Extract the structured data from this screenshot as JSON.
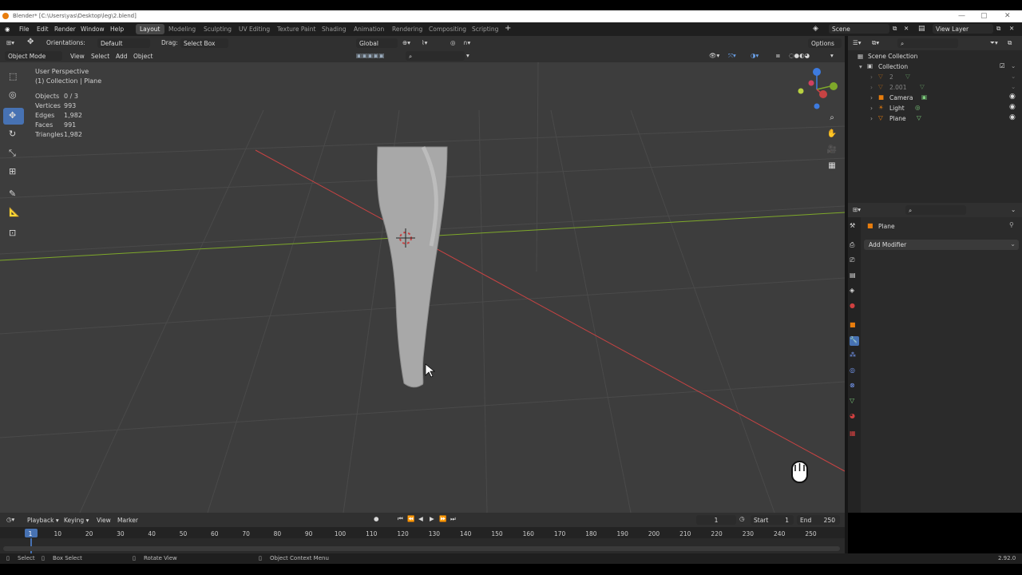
{
  "window_title": "Blender* [C:\\Users\\yas\\Desktop\\leg\\2.blend]",
  "menu": [
    "File",
    "Edit",
    "Render",
    "Window",
    "Help"
  ],
  "workspaces": [
    "Layout",
    "Modeling",
    "Sculpting",
    "UV Editing",
    "Texture Paint",
    "Shading",
    "Animation",
    "Rendering",
    "Compositing",
    "Scripting"
  ],
  "active_workspace": "Layout",
  "scene_field": "Scene",
  "view_layer_field": "View Layer",
  "header": {
    "orientation_label": "Orientations:",
    "orientation_value": "Default",
    "drag_label": "Drag:",
    "drag_value": "Select Box",
    "transform_orientation": "Global",
    "options_label": "Options"
  },
  "header2": {
    "mode": "Object Mode",
    "menus": [
      "View",
      "Select",
      "Add",
      "Object"
    ]
  },
  "viewport": {
    "perspective": "User Perspective",
    "collection": "(1) Collection | Plane",
    "stats": [
      {
        "label": "Objects",
        "value": "0 / 3"
      },
      {
        "label": "Vertices",
        "value": "993"
      },
      {
        "label": "Edges",
        "value": "1,982"
      },
      {
        "label": "Faces",
        "value": "991"
      },
      {
        "label": "Triangles",
        "value": "1,982"
      }
    ]
  },
  "outliner": {
    "rows": [
      {
        "label": "Scene Collection",
        "depth": 0
      },
      {
        "label": "Collection",
        "depth": 1
      },
      {
        "label": "2",
        "depth": 2
      },
      {
        "label": "2.001",
        "depth": 2
      },
      {
        "label": "Camera",
        "depth": 2
      },
      {
        "label": "Light",
        "depth": 2
      },
      {
        "label": "Plane",
        "depth": 2
      }
    ]
  },
  "properties": {
    "object_name": "Plane",
    "add_modifier": "Add Modifier"
  },
  "timeline": {
    "menus": [
      "Playback",
      "Keying",
      "View",
      "Marker"
    ],
    "current_frame": "1",
    "start_label": "Start",
    "start_value": "1",
    "end_label": "End",
    "end_value": "250",
    "frame_ticks": [
      "1",
      "10",
      "20",
      "30",
      "40",
      "50",
      "60",
      "70",
      "80",
      "90",
      "100",
      "110",
      "120",
      "130",
      "140",
      "150",
      "160",
      "170",
      "180",
      "190",
      "200",
      "210",
      "220",
      "230",
      "240",
      "250"
    ]
  },
  "status": {
    "select": "Select",
    "box_select": "Box Select",
    "rotate_view": "Rotate View",
    "context_menu": "Object Context Menu",
    "version": "2.92.0"
  },
  "colors": {
    "accent": "#4772b3",
    "x_axis": "#c74343",
    "y_axis": "#7ea82a",
    "z_axis": "#3d7be0",
    "orange": "#e87d0d"
  }
}
